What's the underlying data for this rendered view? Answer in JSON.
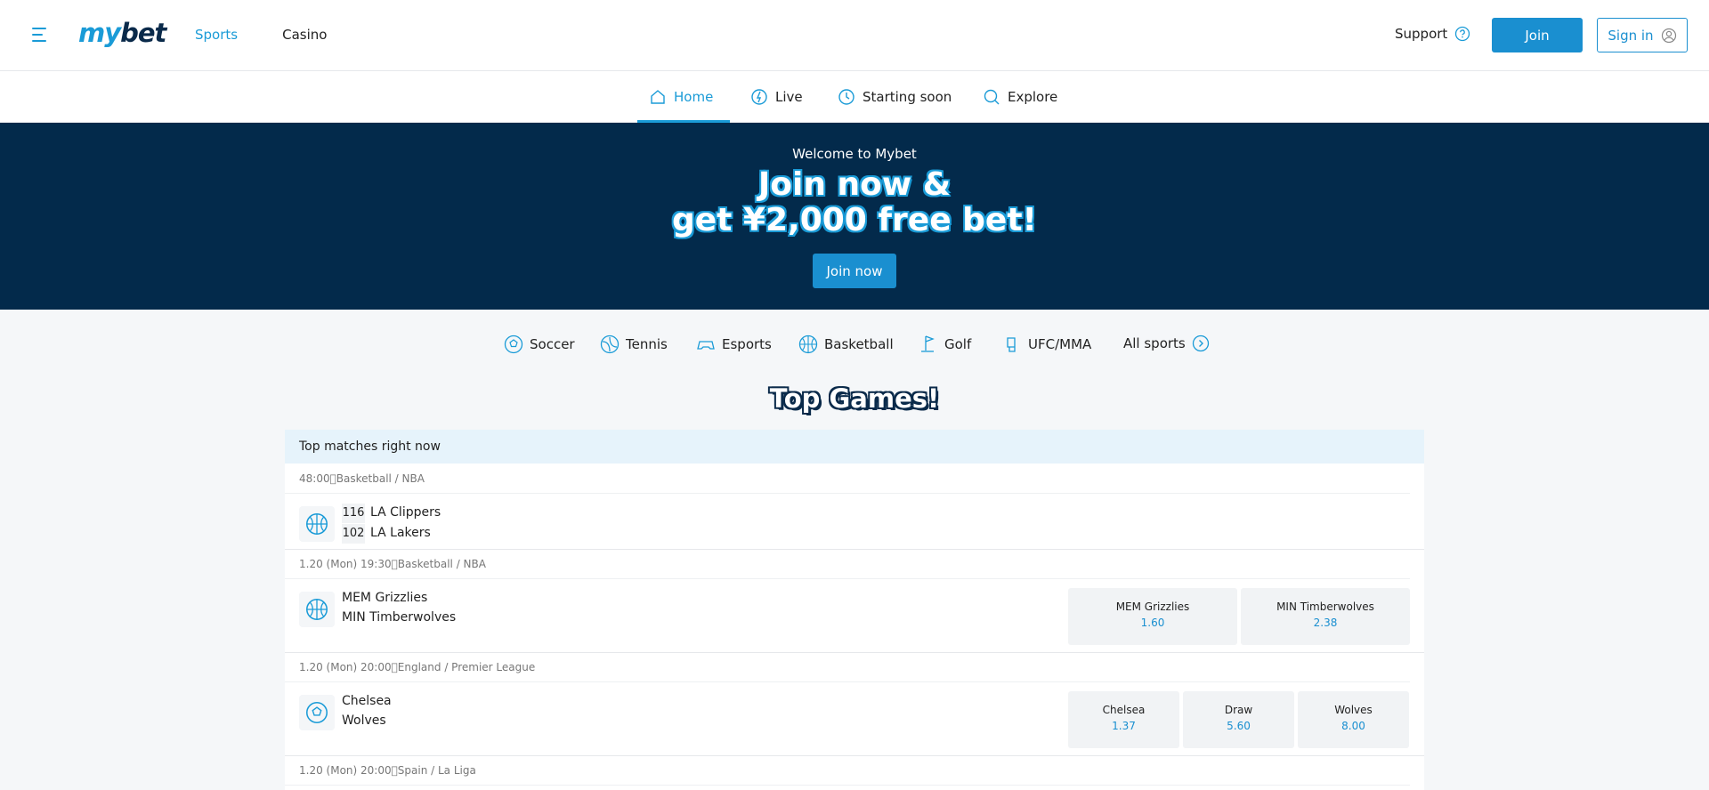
{
  "brand": {
    "my": "my",
    "bet": "bet"
  },
  "topnav": {
    "sports": "Sports",
    "casino": "Casino"
  },
  "header": {
    "support": "Support",
    "join": "Join",
    "signin": "Sign in"
  },
  "subnav": {
    "home": "Home",
    "live": "Live",
    "starting_soon": "Starting soon",
    "explore": "Explore"
  },
  "banner": {
    "welcome": "Welcome to Mybet",
    "line1": "Join now &",
    "line2": "get ¥2,000 free bet!",
    "cta": "Join now"
  },
  "sports": {
    "soccer": "Soccer",
    "tennis": "Tennis",
    "esports": "Esports",
    "basketball": "Basketball",
    "golf": "Golf",
    "ufc": "UFC/MMA",
    "all": "All sports"
  },
  "section_title": "Top Games!",
  "panel_title": "Top matches right now",
  "matches": [
    {
      "meta": "48:00\u0000Basketball / NBA",
      "home": "LA Clippers",
      "away": "LA Lakers",
      "home_score": "116",
      "away_score": "102"
    },
    {
      "meta": "1.20 (Mon) 19:30\u0000Basketball / NBA",
      "home": "MEM Grizzlies",
      "away": "MIN Timberwolves",
      "odds": [
        {
          "label": "MEM Grizzlies",
          "value": "1.60"
        },
        {
          "label": "MIN Timberwolves",
          "value": "2.38"
        }
      ]
    },
    {
      "meta": "1.20 (Mon) 20:00\u0000England / Premier League",
      "home": "Chelsea",
      "away": "Wolves",
      "odds": [
        {
          "label": "Chelsea",
          "value": "1.37"
        },
        {
          "label": "Draw",
          "value": "5.60"
        },
        {
          "label": "Wolves",
          "value": "8.00"
        }
      ]
    },
    {
      "meta": "1.20 (Mon) 20:00\u0000Spain / La Liga"
    }
  ],
  "colors": {
    "accent": "#1a9bd7",
    "navy": "#032a4b",
    "panel_head": "#e6f3fb"
  }
}
